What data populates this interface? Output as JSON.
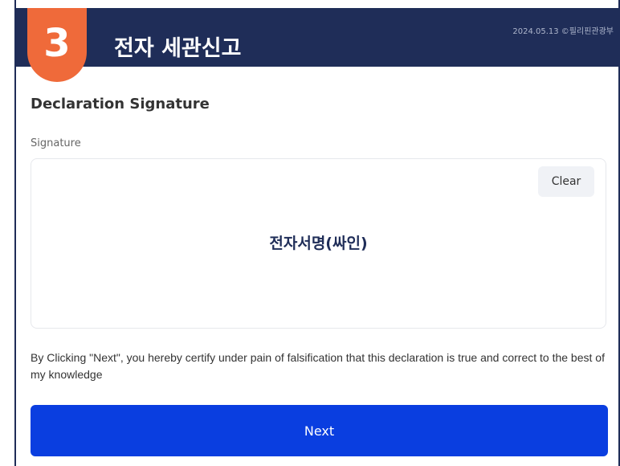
{
  "header": {
    "step": "3",
    "title": "전자 세관신고",
    "meta": "2024.05.13 ©필리핀관광부"
  },
  "section": {
    "title": "Declaration Signature"
  },
  "signature": {
    "label": "Signature",
    "clear_label": "Clear",
    "placeholder": "전자서명(싸인)"
  },
  "certification": {
    "text": "By Clicking \"Next\", you hereby certify under pain of falsification that this declaration is true and correct to the best of my knowledge"
  },
  "actions": {
    "next_label": "Next"
  },
  "colors": {
    "header_bg": "#1f2d58",
    "step_badge": "#ef6a3a",
    "primary_button": "#0a3ee0"
  }
}
